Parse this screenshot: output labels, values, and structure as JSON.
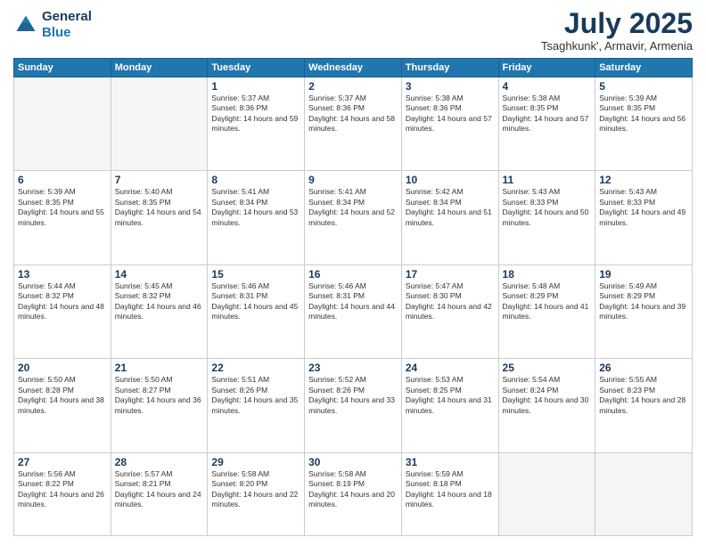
{
  "logo": {
    "line1": "General",
    "line2": "Blue"
  },
  "header": {
    "month": "July 2025",
    "location": "Tsaghkunk', Armavir, Armenia"
  },
  "weekdays": [
    "Sunday",
    "Monday",
    "Tuesday",
    "Wednesday",
    "Thursday",
    "Friday",
    "Saturday"
  ],
  "weeks": [
    [
      {
        "day": "",
        "empty": true
      },
      {
        "day": "",
        "empty": true
      },
      {
        "day": "1",
        "sunrise": "5:37 AM",
        "sunset": "8:36 PM",
        "daylight": "14 hours and 59 minutes."
      },
      {
        "day": "2",
        "sunrise": "5:37 AM",
        "sunset": "8:36 PM",
        "daylight": "14 hours and 58 minutes."
      },
      {
        "day": "3",
        "sunrise": "5:38 AM",
        "sunset": "8:36 PM",
        "daylight": "14 hours and 57 minutes."
      },
      {
        "day": "4",
        "sunrise": "5:38 AM",
        "sunset": "8:35 PM",
        "daylight": "14 hours and 57 minutes."
      },
      {
        "day": "5",
        "sunrise": "5:39 AM",
        "sunset": "8:35 PM",
        "daylight": "14 hours and 56 minutes."
      }
    ],
    [
      {
        "day": "6",
        "sunrise": "5:39 AM",
        "sunset": "8:35 PM",
        "daylight": "14 hours and 55 minutes."
      },
      {
        "day": "7",
        "sunrise": "5:40 AM",
        "sunset": "8:35 PM",
        "daylight": "14 hours and 54 minutes."
      },
      {
        "day": "8",
        "sunrise": "5:41 AM",
        "sunset": "8:34 PM",
        "daylight": "14 hours and 53 minutes."
      },
      {
        "day": "9",
        "sunrise": "5:41 AM",
        "sunset": "8:34 PM",
        "daylight": "14 hours and 52 minutes."
      },
      {
        "day": "10",
        "sunrise": "5:42 AM",
        "sunset": "8:34 PM",
        "daylight": "14 hours and 51 minutes."
      },
      {
        "day": "11",
        "sunrise": "5:43 AM",
        "sunset": "8:33 PM",
        "daylight": "14 hours and 50 minutes."
      },
      {
        "day": "12",
        "sunrise": "5:43 AM",
        "sunset": "8:33 PM",
        "daylight": "14 hours and 49 minutes."
      }
    ],
    [
      {
        "day": "13",
        "sunrise": "5:44 AM",
        "sunset": "8:32 PM",
        "daylight": "14 hours and 48 minutes."
      },
      {
        "day": "14",
        "sunrise": "5:45 AM",
        "sunset": "8:32 PM",
        "daylight": "14 hours and 46 minutes."
      },
      {
        "day": "15",
        "sunrise": "5:46 AM",
        "sunset": "8:31 PM",
        "daylight": "14 hours and 45 minutes."
      },
      {
        "day": "16",
        "sunrise": "5:46 AM",
        "sunset": "8:31 PM",
        "daylight": "14 hours and 44 minutes."
      },
      {
        "day": "17",
        "sunrise": "5:47 AM",
        "sunset": "8:30 PM",
        "daylight": "14 hours and 42 minutes."
      },
      {
        "day": "18",
        "sunrise": "5:48 AM",
        "sunset": "8:29 PM",
        "daylight": "14 hours and 41 minutes."
      },
      {
        "day": "19",
        "sunrise": "5:49 AM",
        "sunset": "8:29 PM",
        "daylight": "14 hours and 39 minutes."
      }
    ],
    [
      {
        "day": "20",
        "sunrise": "5:50 AM",
        "sunset": "8:28 PM",
        "daylight": "14 hours and 38 minutes."
      },
      {
        "day": "21",
        "sunrise": "5:50 AM",
        "sunset": "8:27 PM",
        "daylight": "14 hours and 36 minutes."
      },
      {
        "day": "22",
        "sunrise": "5:51 AM",
        "sunset": "8:26 PM",
        "daylight": "14 hours and 35 minutes."
      },
      {
        "day": "23",
        "sunrise": "5:52 AM",
        "sunset": "8:26 PM",
        "daylight": "14 hours and 33 minutes."
      },
      {
        "day": "24",
        "sunrise": "5:53 AM",
        "sunset": "8:25 PM",
        "daylight": "14 hours and 31 minutes."
      },
      {
        "day": "25",
        "sunrise": "5:54 AM",
        "sunset": "8:24 PM",
        "daylight": "14 hours and 30 minutes."
      },
      {
        "day": "26",
        "sunrise": "5:55 AM",
        "sunset": "8:23 PM",
        "daylight": "14 hours and 28 minutes."
      }
    ],
    [
      {
        "day": "27",
        "sunrise": "5:56 AM",
        "sunset": "8:22 PM",
        "daylight": "14 hours and 26 minutes."
      },
      {
        "day": "28",
        "sunrise": "5:57 AM",
        "sunset": "8:21 PM",
        "daylight": "14 hours and 24 minutes."
      },
      {
        "day": "29",
        "sunrise": "5:58 AM",
        "sunset": "8:20 PM",
        "daylight": "14 hours and 22 minutes."
      },
      {
        "day": "30",
        "sunrise": "5:58 AM",
        "sunset": "8:19 PM",
        "daylight": "14 hours and 20 minutes."
      },
      {
        "day": "31",
        "sunrise": "5:59 AM",
        "sunset": "8:18 PM",
        "daylight": "14 hours and 18 minutes."
      },
      {
        "day": "",
        "empty": true
      },
      {
        "day": "",
        "empty": true
      }
    ]
  ]
}
